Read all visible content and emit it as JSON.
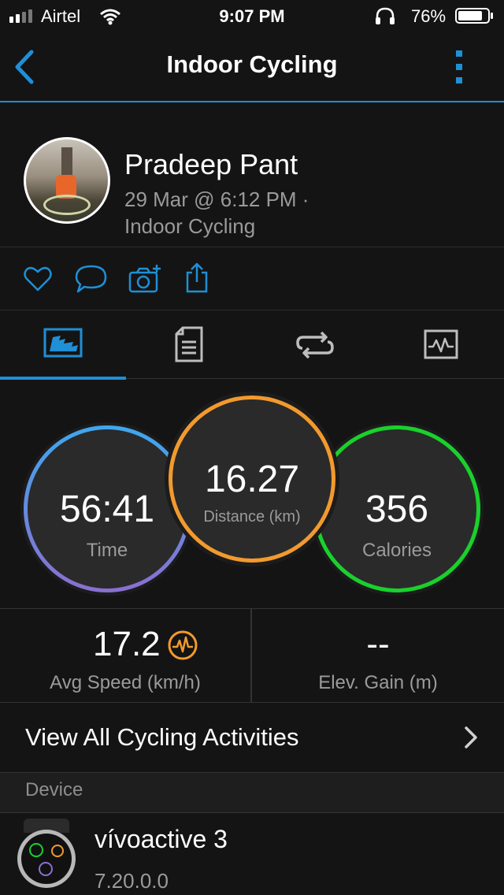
{
  "status": {
    "carrier": "Airtel",
    "time": "9:07 PM",
    "battery": "76%"
  },
  "nav": {
    "title": "Indoor Cycling"
  },
  "profile": {
    "name": "Pradeep Pant",
    "date": "29 Mar @ 6:12 PM ·",
    "activity": "Indoor Cycling"
  },
  "stats": {
    "time": {
      "value": "56:41",
      "label": "Time"
    },
    "distance": {
      "value": "16.27",
      "label": "Distance (km)"
    },
    "calories": {
      "value": "356",
      "label": "Calories"
    },
    "avg_speed": {
      "value": "17.2",
      "label": "Avg Speed (km/h)"
    },
    "elev_gain": {
      "value": "--",
      "label": "Elev. Gain (m)"
    }
  },
  "view_all": "View All Cycling Activities",
  "device_section": "Device",
  "device": {
    "name": "vívoactive 3",
    "version": "7.20.0.0"
  },
  "colors": {
    "accent": "#1f8fd6",
    "time_ring": "#4a9fe0",
    "distance_ring": "#f29a2e",
    "calories_ring": "#19d12c"
  }
}
